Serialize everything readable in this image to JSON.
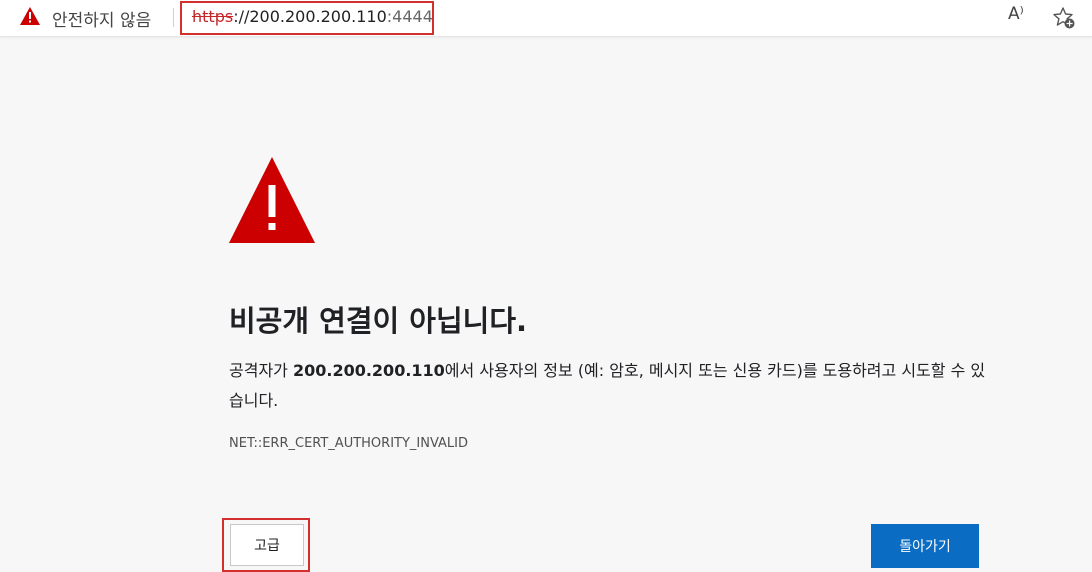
{
  "addressbar": {
    "security_label": "안전하지 않음",
    "url_scheme": "https",
    "url_rest": "://200.200.200.110",
    "url_port": ":4444",
    "read_aloud_label": "A⁾",
    "icons": [
      "warning-icon",
      "read-aloud-icon",
      "add-favorite-icon"
    ]
  },
  "page": {
    "heading": "비공개 연결이 아닙니다.",
    "desc_before": "공격자가 ",
    "desc_host": "200.200.200.110",
    "desc_after": "에서 사용자의 정보 (예: 암호, 메시지 또는 신용 카드)를 도용하려고 시도할 수 있습니다.",
    "error_code": "NET::ERR_CERT_AUTHORITY_INVALID",
    "advanced_button": "고급",
    "back_button": "돌아가기"
  },
  "colors": {
    "warning_red": "#cc0000",
    "highlight_red": "#d32f2f",
    "button_blue": "#0b6cc4",
    "background": "#f7f7f7"
  }
}
